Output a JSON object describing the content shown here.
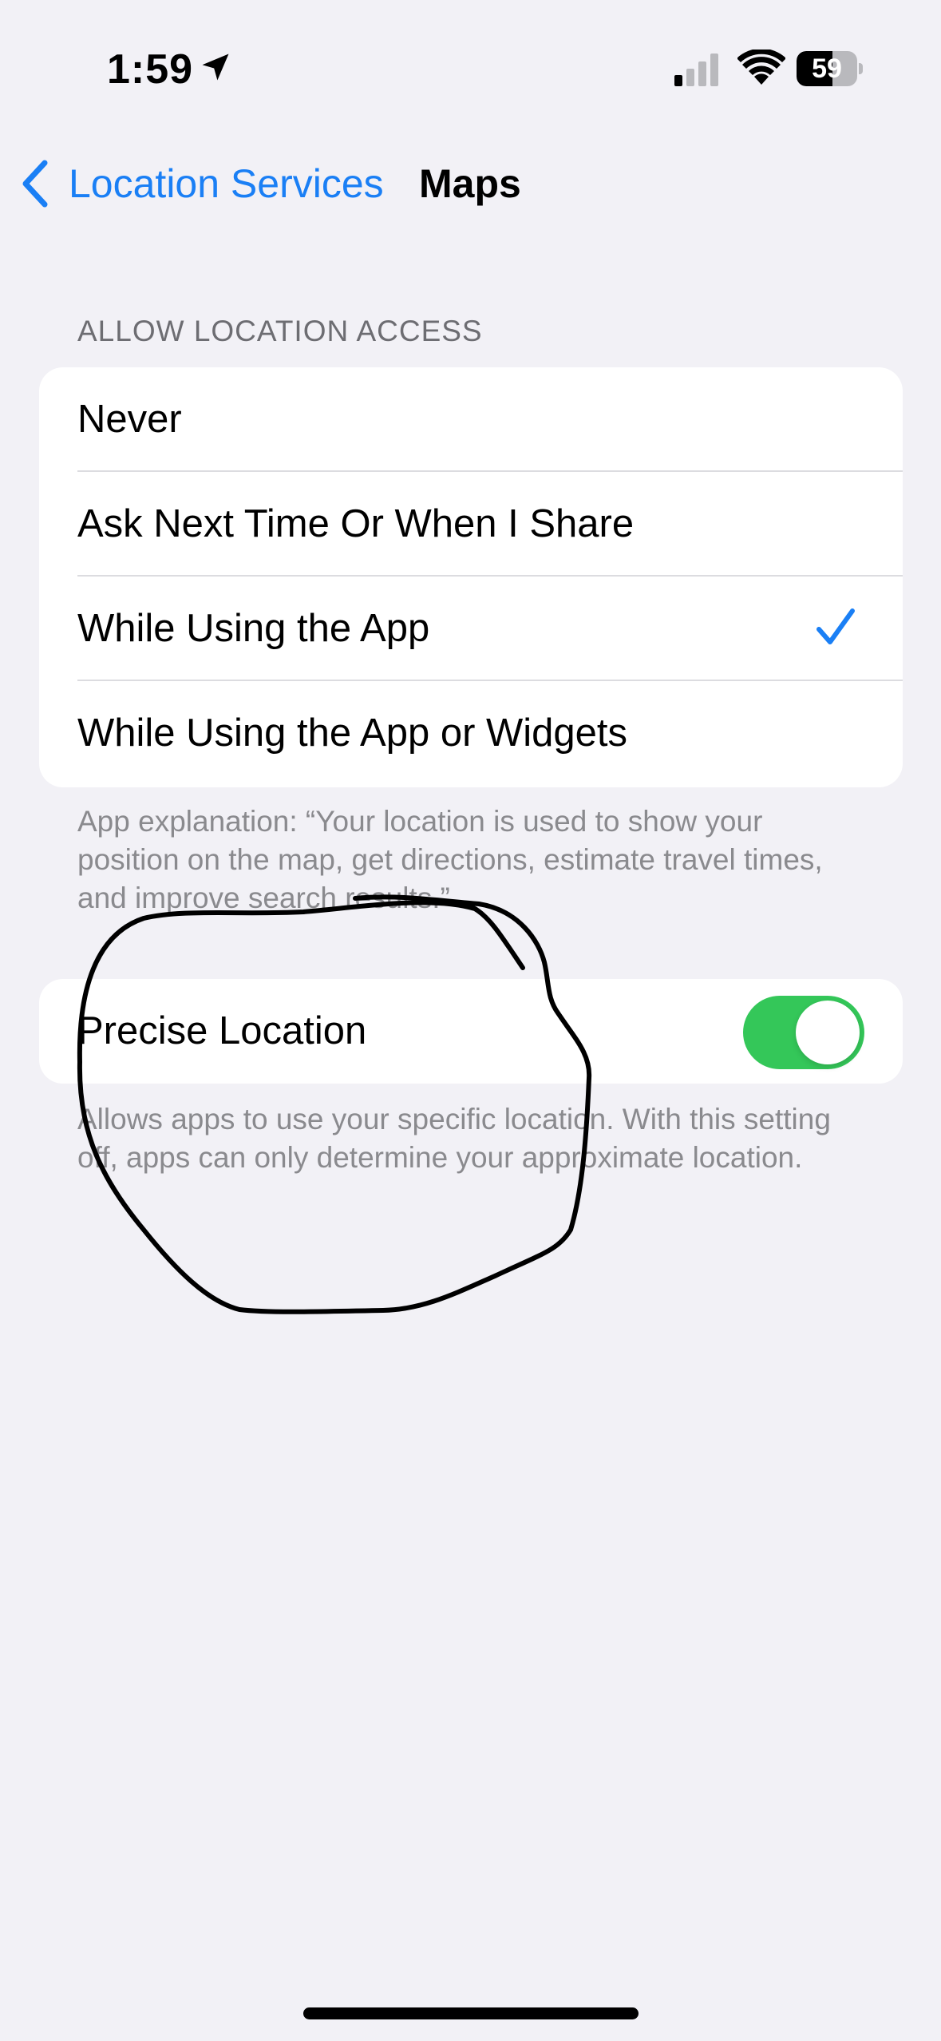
{
  "status_bar": {
    "time": "1:59",
    "battery": "59",
    "battery_level": 0.59,
    "signal_bars_active": 1,
    "signal_bars_total": 4
  },
  "nav": {
    "back_label": "Location Services",
    "title": "Maps"
  },
  "location_access": {
    "header": "ALLOW LOCATION ACCESS",
    "options": [
      {
        "label": "Never",
        "selected": false
      },
      {
        "label": "Ask Next Time Or When I Share",
        "selected": false
      },
      {
        "label": "While Using the App",
        "selected": true
      },
      {
        "label": "While Using the App or Widgets",
        "selected": false
      }
    ],
    "explanation": "App explanation: “Your location is used to show your position on the map, get directions, estimate travel times, and improve search results.”"
  },
  "precise_location": {
    "label": "Precise Location",
    "enabled": true,
    "footer": "Allows apps to use your specific location. With this setting off, apps can only determine your approximate location."
  },
  "colors": {
    "background": "#f2f1f6",
    "accent": "#1a7ff5",
    "toggle_on": "#34c759",
    "secondary_text": "#8a8a8e"
  }
}
